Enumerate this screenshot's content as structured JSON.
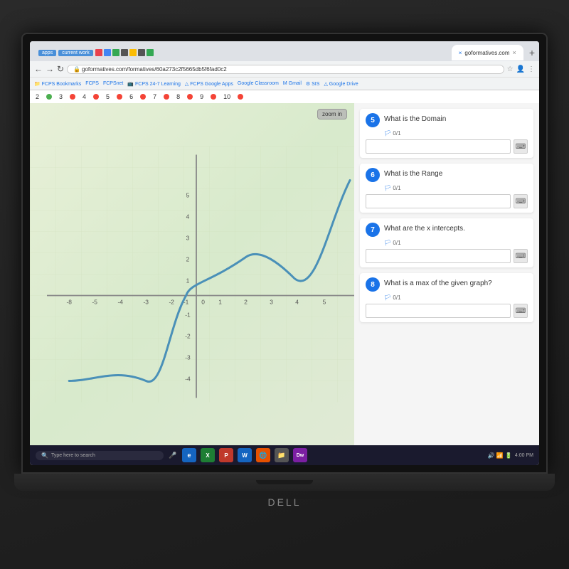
{
  "browser": {
    "url": "goformatives.com/formatives/60a273c2f5665db5f6fad0c2",
    "tab_label": "goformatives.com",
    "apps_label": "apps",
    "current_work_label": "current work",
    "zoom_btn": "zoom in"
  },
  "bookmarks": [
    "FCPS Bookmarks",
    "FCPS",
    "FCPSnet",
    "FCPS 24-7 Learning",
    "FCPS Google Apps",
    "Google Classroom",
    "Gmail",
    "SIS",
    "Google Drive"
  ],
  "number_row": {
    "numbers": [
      "2",
      "3",
      "4",
      "5",
      "6",
      "7",
      "8",
      "9",
      "10"
    ],
    "dot_colors": [
      "#4CAF50",
      "#f44336",
      "#f44336",
      "#f44336",
      "#f44336",
      "#f44336",
      "#f44336",
      "#f44336",
      "#f44336"
    ]
  },
  "questions": [
    {
      "number": "5",
      "text": "What is the Domain",
      "score": "0/1"
    },
    {
      "number": "6",
      "text": "What is the Range",
      "score": "0/1"
    },
    {
      "number": "7",
      "text": "What are the x intercepts.",
      "score": "0/1"
    },
    {
      "number": "8",
      "text": "What is a max of the given graph?",
      "score": "0/1"
    }
  ],
  "graph": {
    "x_labels": [
      "-8",
      "-5",
      "-4",
      "-3",
      "-2",
      "-1",
      "0",
      "1",
      "2",
      "3",
      "4",
      "5"
    ],
    "y_labels": [
      "-4",
      "-3",
      "-2",
      "-1",
      "1",
      "2",
      "3",
      "4",
      "5"
    ]
  },
  "taskbar": {
    "search_placeholder": "Type here to search",
    "brand": "DELL"
  }
}
